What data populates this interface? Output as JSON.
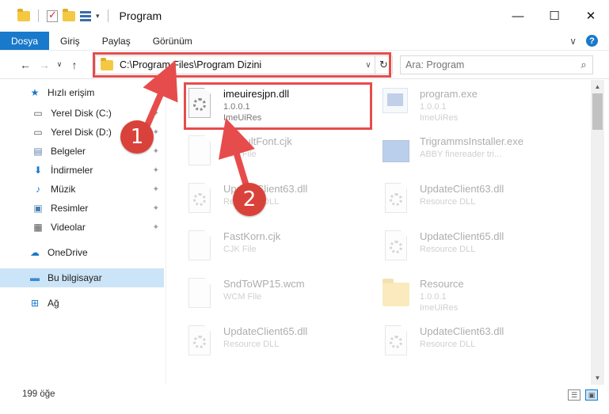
{
  "window": {
    "title": "Program",
    "controls": {
      "minimize": "—",
      "maximize": "☐",
      "close": "✕"
    }
  },
  "ribbon": {
    "tabs": [
      "Dosya",
      "Giriş",
      "Paylaş",
      "Görünüm"
    ],
    "active_tab": "Dosya",
    "expand_glyph": "∨",
    "help_glyph": "?"
  },
  "navigation": {
    "back": "←",
    "forward": "→",
    "recent": "∨",
    "up": "↑",
    "address": "C:\\Program Files\\Program Dizini",
    "address_dropdown": "∨",
    "refresh": "↻",
    "search_placeholder": "Ara: Program",
    "search_icon": "⌕"
  },
  "sidebar": {
    "items": [
      {
        "label": "Hızlı erişim",
        "icon": "star-icon",
        "glyph": "★",
        "color": "#1979ca",
        "pinned": false
      },
      {
        "label": "Yerel Disk (C:)",
        "icon": "drive-icon",
        "glyph": "▭",
        "color": "#555555",
        "pinned": true
      },
      {
        "label": "Yerel Disk (D:)",
        "icon": "drive-icon",
        "glyph": "▭",
        "color": "#555555",
        "pinned": true
      },
      {
        "label": "Belgeler",
        "icon": "documents-icon",
        "glyph": "▤",
        "color": "#5b7fa6",
        "pinned": true
      },
      {
        "label": "İndirmeler",
        "icon": "download-icon",
        "glyph": "⬇",
        "color": "#1979ca",
        "pinned": true
      },
      {
        "label": "Müzik",
        "icon": "music-icon",
        "glyph": "♪",
        "color": "#1979ca",
        "pinned": true
      },
      {
        "label": "Resimler",
        "icon": "pictures-icon",
        "glyph": "▣",
        "color": "#4a7fb5",
        "pinned": true
      },
      {
        "label": "Videolar",
        "icon": "video-icon",
        "glyph": "▦",
        "color": "#555555",
        "pinned": true
      },
      {
        "label": "OneDrive",
        "icon": "onedrive-icon",
        "glyph": "☁",
        "color": "#1979ca",
        "pinned": false
      },
      {
        "label": "Bu bilgisayar",
        "icon": "computer-icon",
        "glyph": "▬",
        "color": "#3a8ad6",
        "pinned": false
      },
      {
        "label": "Ağ",
        "icon": "network-icon",
        "glyph": "⊞",
        "color": "#1979ca",
        "pinned": false
      }
    ],
    "selected": "Bu bilgisayar",
    "pin_glyph": "📌"
  },
  "files": [
    {
      "name": "imeuiresjpn.dll",
      "line1": "1.0.0.1",
      "line2": "ImeUiRes",
      "icon": "dll-icon",
      "highlighted": true
    },
    {
      "name": "program.exe",
      "line1": "1.0.0.1",
      "line2": "ImeUiRes",
      "icon": "exe-icon",
      "highlighted": false
    },
    {
      "name": "DefaultFont.cjk",
      "line1": "CJK File",
      "line2": "",
      "icon": "file-icon",
      "highlighted": false
    },
    {
      "name": "TrigrammsInstaller.exe",
      "line1": "ABBY finereader tri...",
      "line2": "",
      "icon": "installer-icon",
      "highlighted": false
    },
    {
      "name": "UpdateClient63.dll",
      "line1": "Resource DLL",
      "line2": "",
      "icon": "dll-icon",
      "highlighted": false
    },
    {
      "name": "UpdateClient63.dll",
      "line1": "Resource DLL",
      "line2": "",
      "icon": "dll-icon",
      "highlighted": false
    },
    {
      "name": "FastKorn.cjk",
      "line1": "CJK File",
      "line2": "",
      "icon": "file-icon",
      "highlighted": false
    },
    {
      "name": "UpdateClient65.dll",
      "line1": "Resource DLL",
      "line2": "",
      "icon": "dll-icon",
      "highlighted": false
    },
    {
      "name": "SndToWP15.wcm",
      "line1": "WCM File",
      "line2": "",
      "icon": "file-icon",
      "highlighted": false
    },
    {
      "name": "Resource",
      "line1": "1.0.0.1",
      "line2": "ImeUiRes",
      "icon": "folder-icon",
      "highlighted": false
    },
    {
      "name": "UpdateClient65.dll",
      "line1": "Resource DLL",
      "line2": "",
      "icon": "dll-icon",
      "highlighted": false
    },
    {
      "name": "UpdateClient63.dll",
      "line1": "Resource DLL",
      "line2": "",
      "icon": "dll-icon",
      "highlighted": false
    }
  ],
  "status": {
    "item_count": "199 öğe"
  },
  "annotations": {
    "marker1": "1",
    "marker2": "2",
    "color": "#e74c4c"
  }
}
